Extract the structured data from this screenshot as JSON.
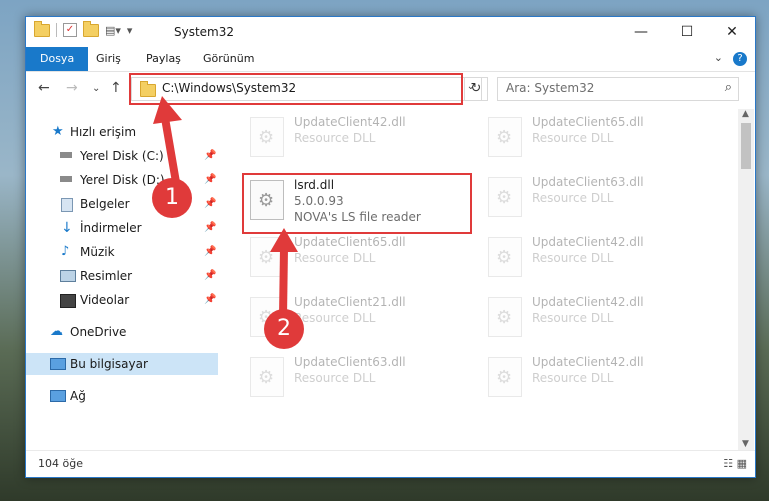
{
  "window": {
    "title": "System32"
  },
  "controls": {
    "minimize": "—",
    "maximize": "☐",
    "close": "✕"
  },
  "ribbon": {
    "tabs": [
      "Dosya",
      "Giriş",
      "Paylaş",
      "Görünüm"
    ],
    "help": "?"
  },
  "address": {
    "path": "C:\\Windows\\System32"
  },
  "search": {
    "placeholder": "Ara: System32"
  },
  "sidebar": {
    "items": [
      {
        "label": "Hızlı erişim"
      },
      {
        "label": "Yerel Disk (C:)"
      },
      {
        "label": "Yerel Disk (D:)"
      },
      {
        "label": "Belgeler"
      },
      {
        "label": "İndirmeler"
      },
      {
        "label": "Müzik"
      },
      {
        "label": "Resimler"
      },
      {
        "label": "Videolar"
      },
      {
        "label": "OneDrive"
      },
      {
        "label": "Bu bilgisayar"
      },
      {
        "label": "Ağ"
      }
    ]
  },
  "files": {
    "highlight": {
      "name": "lsrd.dll",
      "version": "5.0.0.93",
      "desc": "NOVA's LS file reader"
    },
    "others": [
      {
        "name": "UpdateClient42.dll",
        "type": "Resource DLL"
      },
      {
        "name": "UpdateClient65.dll",
        "type": "Resource DLL"
      },
      {
        "name": "UpdateClient63.dll",
        "type": "Resource DLL"
      },
      {
        "name": "UpdateClient65.dll",
        "type": "Resource DLL"
      },
      {
        "name": "UpdateClient42.dll",
        "type": "Resource DLL"
      },
      {
        "name": "UpdateClient21.dll",
        "type": "Resource DLL"
      },
      {
        "name": "UpdateClient42.dll",
        "type": "Resource DLL"
      },
      {
        "name": "UpdateClient63.dll",
        "type": "Resource DLL"
      },
      {
        "name": "UpdateClient42.dll",
        "type": "Resource DLL"
      }
    ]
  },
  "status": {
    "count": "104 öğe"
  },
  "annotations": {
    "badge1": "1",
    "badge2": "2"
  }
}
